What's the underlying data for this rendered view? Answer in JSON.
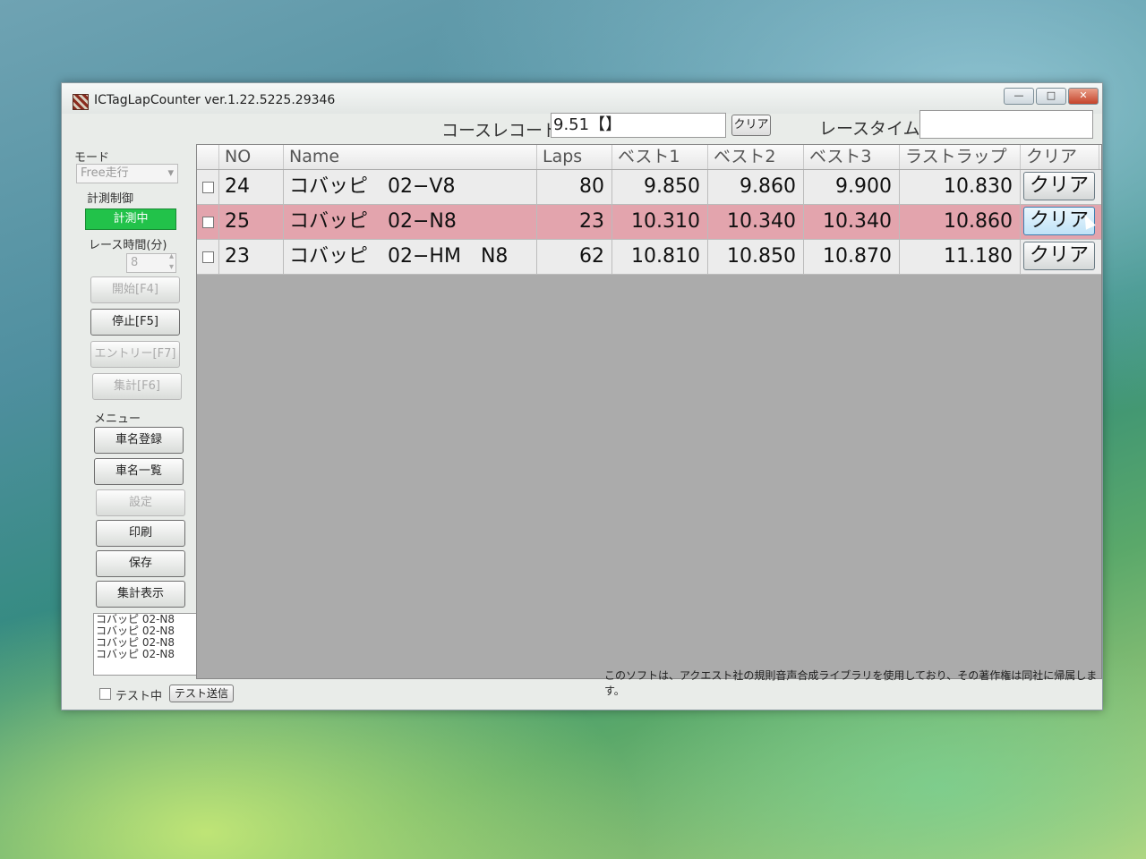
{
  "window": {
    "title": "ICTagLapCounter ver.1.22.5225.29346",
    "minimize": "—",
    "maximize": "□",
    "close": "✕"
  },
  "top": {
    "course_record_label": "コースレコード",
    "course_record_value": "9.51【】",
    "clear_label": "クリア",
    "race_time_label": "レースタイム",
    "race_time_value": ""
  },
  "sidebar": {
    "mode_label": "モード",
    "mode_value": "Free走行",
    "control_label": "計測制御",
    "status": "計測中",
    "race_time_label": "レース時間(分)",
    "race_time_value": "8",
    "start": "開始[F4]",
    "stop": "停止[F5]",
    "entry": "エントリー[F7]",
    "tally": "集計[F6]",
    "menu_label": "メニュー",
    "register": "車名登録",
    "list": "車名一覧",
    "settings": "設定",
    "print": "印刷",
    "save": "保存",
    "tally_display": "集計表示",
    "log": [
      "コバッピ 02-N8",
      "コバッピ 02-N8",
      "コバッピ 02-N8",
      "コバッピ 02-N8"
    ],
    "test_mode": "テスト中",
    "test_send": "テスト送信"
  },
  "table": {
    "headers": [
      "NO",
      "Name",
      "Laps",
      "ベスト1",
      "ベスト2",
      "ベスト3",
      "ラストラップ",
      "クリア"
    ],
    "rows": [
      {
        "no": "24",
        "name": "コバッピ　02−V8",
        "laps": "80",
        "best1": "9.850",
        "best2": "9.860",
        "best3": "9.900",
        "last": "10.830",
        "btn": "クリア"
      },
      {
        "no": "25",
        "name": "コバッピ　02−N8",
        "laps": "23",
        "best1": "10.310",
        "best2": "10.340",
        "best3": "10.340",
        "last": "10.860",
        "btn": "クリア"
      },
      {
        "no": "23",
        "name": "コバッピ　02−HM　N8",
        "laps": "62",
        "best1": "10.810",
        "best2": "10.850",
        "best3": "10.870",
        "last": "11.180",
        "btn": "クリア"
      }
    ]
  },
  "status_bar": "このソフトは、アクエスト社の規則音声合成ライブラリを使用しており、その著作権は同社に帰属します。",
  "colors": {
    "selected_row": "#e3a4ad",
    "status_green": "#22c24a"
  }
}
